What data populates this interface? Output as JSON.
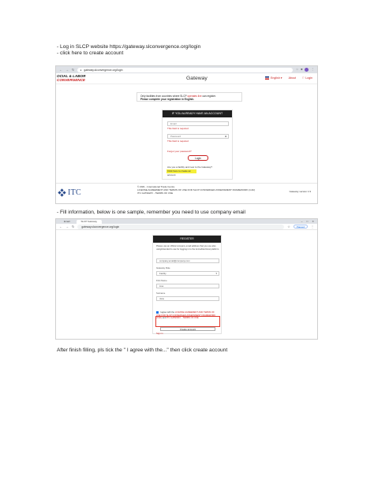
{
  "instructions": {
    "step1_line1": "- Log in SLCP website https://gateway.slconvergence.org/login",
    "step1_line2": "- click here to create account",
    "step2": "- Fill information, below is one sample,  remember you need to use company email",
    "step3": "After finish filling, pls tick the \" I agree with the...\" then click create account"
  },
  "screenshot1": {
    "url": "gateway.slconvergence.org/login",
    "logo_line1": "OCIAL & LABOR",
    "logo_line2": "CONVERGENCE",
    "site_title": "Gateway",
    "nav": {
      "language": "English",
      "about": "About",
      "login": "Login"
    },
    "notice_line1_a": "Only facilities from countries where SLCP",
    "notice_line1_b": "operates live",
    "notice_line1_c": "can register.",
    "notice_line2": "Please complete your registration in English.",
    "login_header": "IF YOU ALREADY HAVE AN ACCOUNT",
    "email_placeholder": "Email",
    "email_error": "This field is required",
    "password_placeholder": "Password",
    "password_error": "This field is required",
    "forgot": "Forgot your password?",
    "login_button": "Login",
    "new_question": "Are you a facility and new to the Gateway?",
    "create_link": "Click here to create an account",
    "itc_logo": "ITC",
    "copyright": "© 2021 - International Trade Centre",
    "license": "LICENSE AGREEMENT AND TERMS OF USE FOR SLCP CONVERGED ASSESSMENT FRAMEWORK (CAF)",
    "terms": "ITC GATEWAY - TERMS OF USE",
    "version": "Gateway version 1.9"
  },
  "screenshot2": {
    "tab1": "Email",
    "tab2": "SLCP Gateway",
    "url": "gateway.slconvergence.org/login",
    "paused": "Paused",
    "reg_header": "REGISTER",
    "reg_note": "Please use an official company email address that you use also using/intended to use for logging in to the Accredited Host platform.",
    "email_value": "company.email@company.com",
    "user_role_label": "Gateway Role",
    "user_role_value": "Facility",
    "first_name_label": "First Name",
    "first_name_value": "Lisa",
    "last_name_label": "Surname",
    "last_name_value": "Jane",
    "agree_prefix": "I agree with the",
    "agree_link": "LICENSE AGREEMENT AND TERMS OF USE FOR SLCP CONVERGED ASSESSMENT FRAMEWORK (CAF)",
    "agree_mid": "and",
    "agree_link2": "ITC GATEWAY - TERMS OF USE",
    "create_button": "Create account",
    "signin_link": "Sign in"
  },
  "colors": {
    "brand_red": "#c81e1e",
    "highlight": "#f5ef3a",
    "header_dark": "#1f1f1f",
    "itc_blue": "#2a4b8c"
  }
}
